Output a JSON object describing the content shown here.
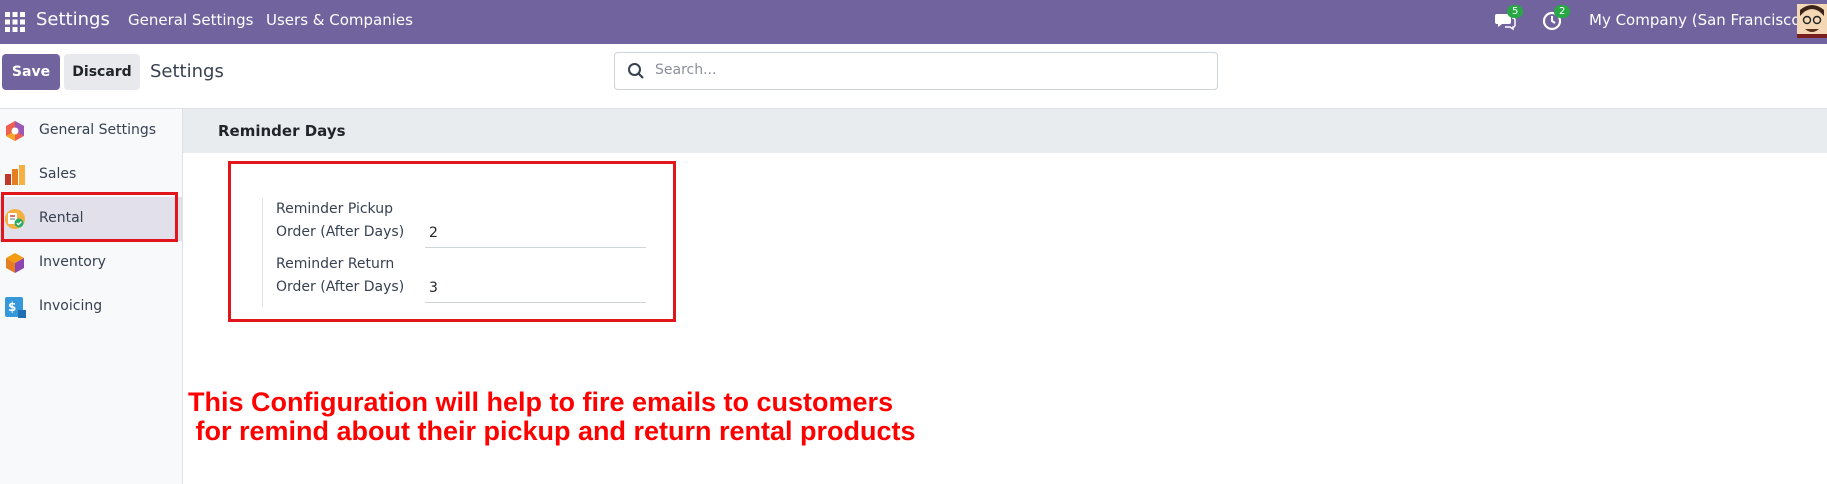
{
  "navbar": {
    "brand": "Settings",
    "menus": [
      "General Settings",
      "Users & Companies"
    ],
    "messages_count": "5",
    "activities_count": "2",
    "company": "My Company (San Francisco)"
  },
  "control": {
    "save_label": "Save",
    "discard_label": "Discard",
    "title": "Settings",
    "search_placeholder": "Search..."
  },
  "sidebar": {
    "items": [
      {
        "label": "General Settings",
        "icon": "general-settings-icon"
      },
      {
        "label": "Sales",
        "icon": "sales-icon"
      },
      {
        "label": "Rental",
        "icon": "rental-icon",
        "active": true
      },
      {
        "label": "Inventory",
        "icon": "inventory-icon"
      },
      {
        "label": "Invoicing",
        "icon": "invoicing-icon"
      }
    ]
  },
  "section": {
    "title": "Reminder Days",
    "fields": [
      {
        "label_line1": "Reminder Pickup",
        "label_line2": "Order (After Days)",
        "value": "2"
      },
      {
        "label_line1": "Reminder Return",
        "label_line2": "Order (After Days)",
        "value": "3"
      }
    ]
  },
  "annotation": {
    "line1": "This Configuration will help to fire emails to customers",
    "line2": " for remind about their pickup and return rental products"
  },
  "colors": {
    "brand": "#71639e",
    "annotation_red": "#ff0000",
    "highlight_box": "#e0161c",
    "badge": "#28a745"
  }
}
